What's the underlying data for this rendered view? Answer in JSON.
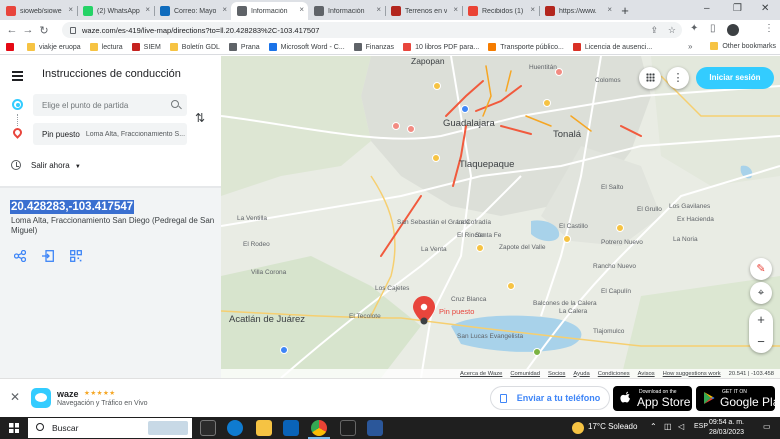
{
  "browser": {
    "tabs": [
      {
        "label": "sioweb/siowe",
        "color": "#e8453c"
      },
      {
        "label": "(2) WhatsApp",
        "color": "#25d366"
      },
      {
        "label": "Correo: Mayo",
        "color": "#0f6cbd"
      },
      {
        "label": "Información",
        "color": "#5f6368",
        "active": true
      },
      {
        "label": "Información",
        "color": "#5f6368"
      },
      {
        "label": "Terrenos en v",
        "color": "#b3261e"
      },
      {
        "label": "Recibidos (1)",
        "color": "#ea4335"
      },
      {
        "label": "https://www.",
        "color": "#b3261e"
      }
    ],
    "new_tab": "+",
    "url": "waze.com/es-419/live-map/directions?to=ll.20.428283%2C-103.417507",
    "bookmarks": [
      {
        "label": "",
        "color": "#e50914"
      },
      {
        "label": "viakje eruopa",
        "color": "#f6c343"
      },
      {
        "label": "lectura",
        "color": "#f6c343"
      },
      {
        "label": "SIEM",
        "color": "#c5221f"
      },
      {
        "label": "Boletín GDL",
        "color": "#f6c343"
      },
      {
        "label": "Prana",
        "color": "#5f6368"
      },
      {
        "label": "Microsoft Word - C...",
        "color": "#1a73e8"
      },
      {
        "label": "Finanzas",
        "color": "#5f6368"
      },
      {
        "label": "10 libros PDF para...",
        "color": "#e8453c"
      },
      {
        "label": "Transporte público...",
        "color": "#f57c00"
      },
      {
        "label": "Licencia de ausenci...",
        "color": "#d93025"
      }
    ],
    "other_bookmarks": "Other bookmarks"
  },
  "panel": {
    "title": "Instrucciones de conducción",
    "start_placeholder": "Elige el punto de partida",
    "destination_label": "Pin puesto",
    "destination_detail": "Loma Alta, Fraccionamiento S...",
    "depart_label": "Salir ahora",
    "coords": "20.428283,-103.417547",
    "address": "Loma Alta, Fraccionamiento San Diego (Pedregal de San Miguel)"
  },
  "map": {
    "login_label": "Iniciar sesión",
    "pin_label": "Pin puesto",
    "labels": {
      "zapopan": "Zapopan",
      "guadalajara": "Guadalajara",
      "tlaquepaque": "Tlaquepaque",
      "tonala": "Tonalá",
      "villa_corona": "Villa Corona",
      "acatlan": "Acatlán de Juárez",
      "los_cajetes": "Los Cajetes",
      "el_tecolote": "El Tecolote",
      "cruz_blanca": "Cruz Blanca",
      "colomos": "Colomos",
      "el_salto": "El Salto",
      "el_grullo": "El Grullo",
      "ex_hacienda": "Ex Hacienda",
      "el_capulin": "El Capulín",
      "la_calera": "La Calera",
      "rancho_nuevo": "Rancho Nuevo",
      "san_lucas": "San Lucas Evangelista",
      "huentitan": "Huentitán",
      "la_venta": "La Venta",
      "el_castillo": "El Castillo",
      "santa_fe": "Santa Fe",
      "zapote": "Zapote del Valle",
      "balcones": "Balcones de la Calera",
      "tlajomulco": "Tlajomulco",
      "el_rodeo": "El Rodeo",
      "la_ventilla": "La Ventilla",
      "potrero": "Potrero Nuevo",
      "los_gavilanes": "Los Gavilanes",
      "la_noria": "La Noria",
      "sebastian": "San Sebastián el Grande",
      "la_cofradia": "La Cofradía",
      "el_rincon": "El Rincón"
    },
    "footer": [
      "Acerca de Waze",
      "Comunidad",
      "Socios",
      "Ayuda",
      "Condiciones",
      "Avisos",
      "How suggestions work"
    ],
    "footer_coords": "20.541 | -103.458"
  },
  "banner": {
    "app_name": "waze",
    "stars": "★★★★★",
    "subtitle": "Navegación y Tráfico en Vivo",
    "send_label": "Enviar a tu teléfono",
    "appstore_small": "Download on the",
    "appstore_large": "App Store",
    "gplay_small": "GET IT ON",
    "gplay_large": "Google Play"
  },
  "taskbar": {
    "search_label": "Buscar",
    "weather": "17°C Soleado",
    "lang": "ESP",
    "time": "09:54 a. m.",
    "date": "28/03/2023"
  }
}
